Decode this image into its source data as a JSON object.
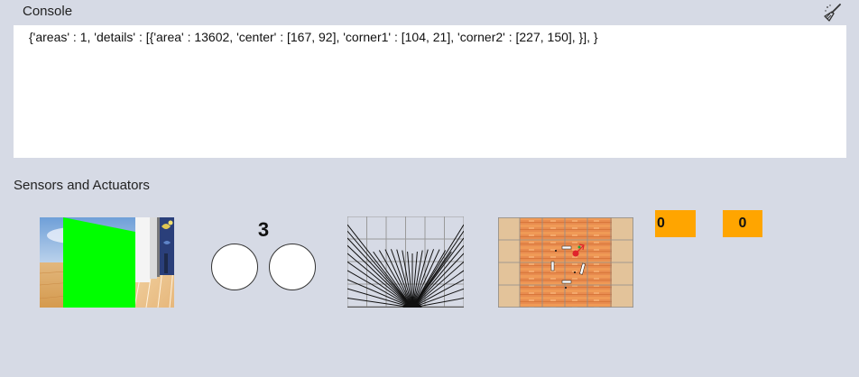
{
  "console": {
    "title": "Console",
    "clear_icon": "broom-icon",
    "output": "{'areas' : 1, 'details' : [{'area' : 13602, 'center' : [167, 92], 'corner1' : [104, 21], 'corner2' : [227, 150], }], }"
  },
  "sensors": {
    "title": "Sensors and Actuators",
    "bumper_count": "3",
    "counters": [
      "0",
      "0"
    ]
  },
  "colors": {
    "background": "#d6dae5",
    "console_background": "#ffffff",
    "detected_blob": "#00ff00",
    "counter_background": "#ffa500"
  }
}
